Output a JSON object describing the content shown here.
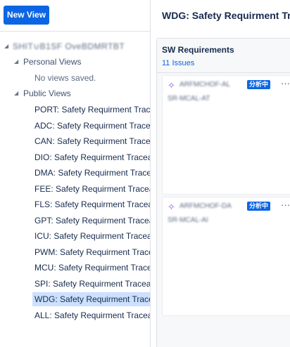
{
  "left_panel": {
    "new_view_label": "New View",
    "project_name": "SHIT∪B1SF OveBDMRTBT",
    "personal_views": {
      "label": "Personal Views",
      "empty_text": "No views saved."
    },
    "public_views": {
      "label": "Public Views",
      "items": [
        "PORT: Safety Requirment Traceabi",
        "ADC: Safety Requirment Traceabili",
        "CAN: Safety Requirment Traceabili",
        "DIO: Safety Requirment Traceability",
        "DMA: Safety Requirment Traceabilit",
        "FEE: Safety Requirment Traceabilit",
        "FLS: Safety Requirment Traceabilit",
        "GPT: Safety Requirment Traceabilit",
        "ICU: Safety Requirment Traceability",
        "PWM: Safety Requirment Traceabil",
        "MCU: Safety Requirment Traceabili",
        "SPI: Safety Requirment Traceability",
        "WDG: Safety Requirment Traceabi",
        "ALL: Safety Requirment Traceabilit"
      ],
      "selected_index": 12
    }
  },
  "right_panel": {
    "title": "WDG: Safety Requirment Traceabi",
    "column": {
      "title": "SW Requirements",
      "count": "11 Issues",
      "cards": [
        {
          "key": "ARFMCHOF-AL",
          "status": "分析中",
          "summary": "SR-MCAL-AT",
          "more": "···"
        },
        {
          "key": "ARFMCHOF-DA",
          "status": "分析中",
          "summary": "SR-MCAL-AI",
          "more": "···"
        }
      ]
    }
  },
  "colors": {
    "accent": "#0c66e4",
    "selected_bg": "#cce0ff",
    "story_icon": "#8f5cde"
  }
}
